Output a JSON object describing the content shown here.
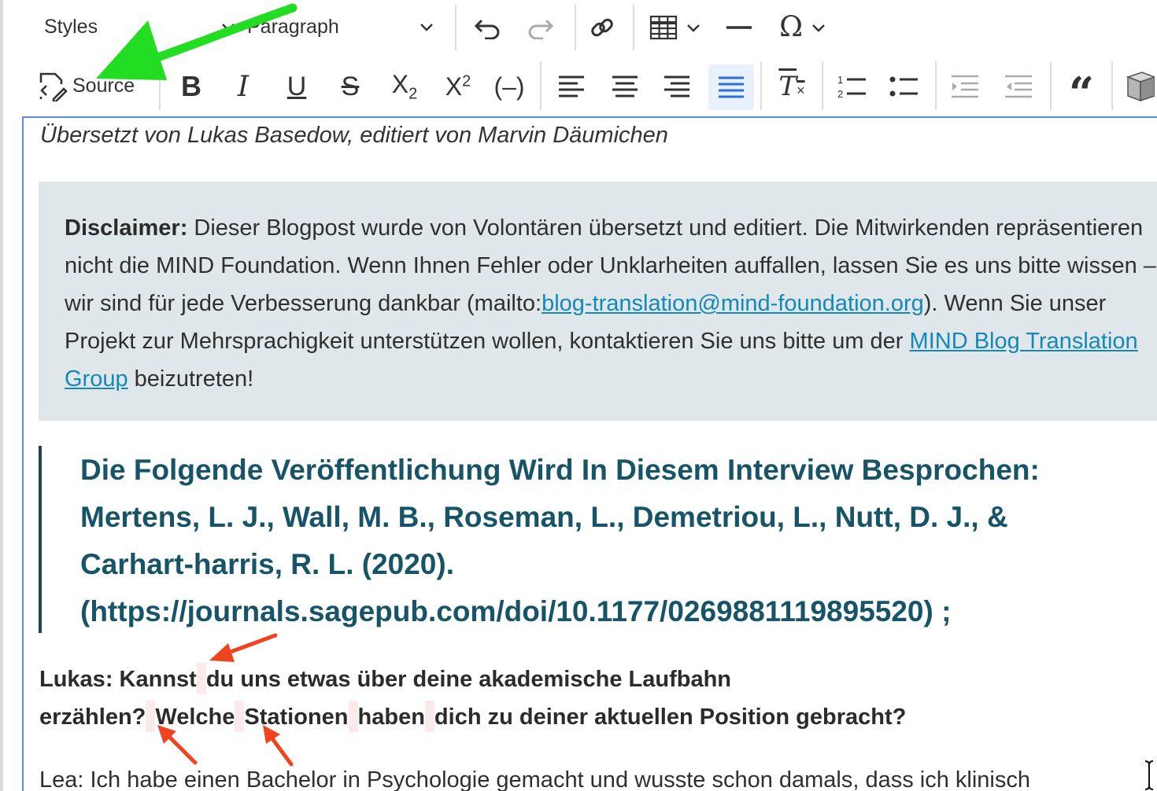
{
  "toolbar": {
    "styles_label": "Styles",
    "format_label": "Paragraph",
    "source_label": "Source",
    "icons": [
      "undo-icon",
      "redo-icon",
      "link-icon",
      "table-icon",
      "horizontal-line-icon",
      "special-character-icon",
      "bold-icon",
      "italic-icon",
      "underline-icon",
      "strikethrough-icon",
      "subscript-icon",
      "superscript-icon",
      "code-icon",
      "align-left-icon",
      "align-center-icon",
      "align-right-icon",
      "justify-icon",
      "remove-format-icon",
      "numbered-list-icon",
      "bulleted-list-icon",
      "outdent-icon",
      "indent-icon",
      "blockquote-icon",
      "media-icon"
    ],
    "active": "justify"
  },
  "content": {
    "byline": "Übersetzt von Lukas Basedow, editiert von Marvin Däumichen",
    "disclaimer": {
      "label": "Disclaimer:",
      "text_1": " Dieser Blogpost wurde von Volontären übersetzt und editiert. Die Mitwirkenden repräsentieren nicht die MIND Foundation. Wenn Ihnen Fehler oder Unklarheiten auffallen, lassen Sie es uns bitte wissen – wir sind für jede Verbesserung dankbar (mailto:",
      "link_email": "blog-translation@mind-foundation.org",
      "text_2": "). Wenn Sie unser Projekt zur Mehrsprachigkeit unterstützen wollen, kontaktieren Sie uns bitte um der ",
      "link_group": "MIND Blog Translation Group",
      "text_3": " beizutreten!"
    },
    "quote": "Die Folgende Veröffentlichung Wird In Diesem Interview Besprochen: Mertens, L. J., Wall, M. B., Roseman, L., Demetriou, L., Nutt, D. J., & Carhart-harris, R. L. (2020). (https://journals.sagepub.com/doi/10.1177/0269881119895520) ;",
    "question": {
      "w1": "Lukas: Kannst",
      "w2": "du uns etwas über deine akademische Laufbahn",
      "w3": "erzählen?",
      "w4": "Welche",
      "w5": "Stationen",
      "w6": "haben",
      "w7": "dich zu deiner aktuellen Position gebracht?"
    },
    "answer": "Lea: Ich habe einen Bachelor in Psychologie gemacht und wusste schon damals, dass ich klinisch"
  },
  "colors": {
    "accent": "#5b8ed8",
    "disclaimer_bg": "#e0e7ea",
    "quote_text": "#185468",
    "link": "#1488b8",
    "highlight": "#fce9ea",
    "annotation_green": "#22dd22",
    "annotation_red": "#f0431f"
  }
}
